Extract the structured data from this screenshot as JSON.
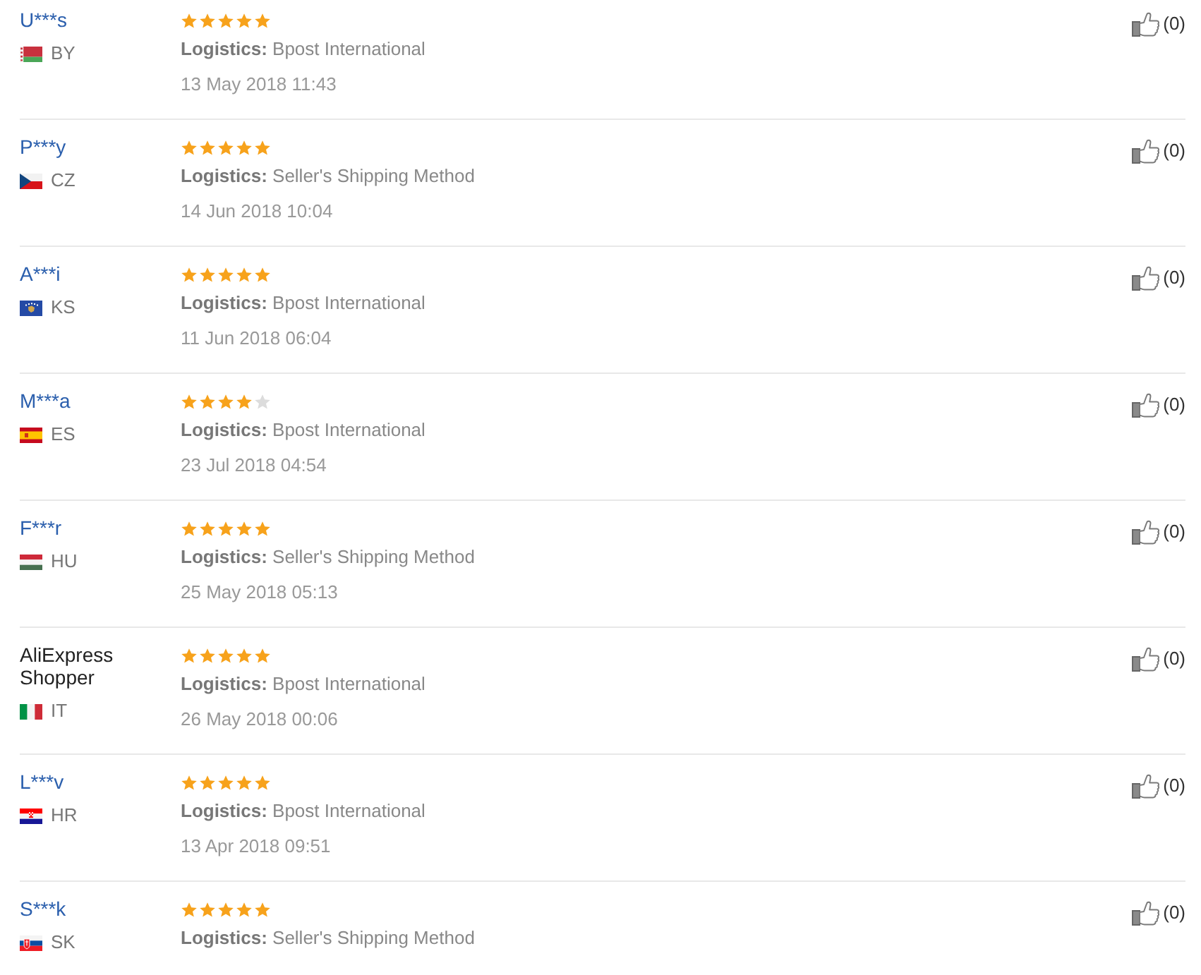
{
  "reviews": [
    {
      "kind": "link",
      "name": "U***s",
      "country": {
        "kind": "belarus",
        "code": "BY"
      },
      "stars": 5,
      "logistics": "**Logistics:** Bpost International",
      "date": "13 May 2018 11:43",
      "likes": "(0)"
    },
    {
      "kind": "link",
      "name": "P***y",
      "country": {
        "kind": "czechia",
        "code": "CZ"
      },
      "stars": 5,
      "logistics": "**Logistics:** Seller's Shipping Method",
      "date": "14 Jun 2018 10:04",
      "likes": "(0)"
    },
    {
      "kind": "link",
      "name": "A***i",
      "country": {
        "kind": "kosovo",
        "code": "KS"
      },
      "stars": 5,
      "logistics": "**Logistics:** Bpost International",
      "date": "11 Jun 2018 06:04",
      "likes": "(0)"
    },
    {
      "kind": "link",
      "name": "M***a",
      "country": {
        "kind": "spain",
        "code": "ES"
      },
      "stars": 4,
      "logistics": "**Logistics:** Bpost International",
      "date": "23 Jul 2018 04:54",
      "likes": "(0)"
    },
    {
      "kind": "link",
      "name": "F***r",
      "country": {
        "kind": "hungary",
        "code": "HU"
      },
      "stars": 5,
      "logistics": "**Logistics:** Seller's Shipping Method",
      "date": "25 May 2018 05:13",
      "likes": "(0)"
    },
    {
      "kind": "plain",
      "name": "AliExpress Shopper",
      "country": {
        "kind": "italy",
        "code": "IT"
      },
      "stars": 5,
      "logistics": "**Logistics:** Bpost International",
      "date": "26 May 2018 00:06",
      "likes": "(0)"
    },
    {
      "kind": "link",
      "name": "L***v",
      "country": {
        "kind": "croatia",
        "code": "HR"
      },
      "stars": 5,
      "logistics": "**Logistics:** Bpost International",
      "date": "13 Apr 2018 09:51",
      "likes": "(0)"
    },
    {
      "kind": "link",
      "name": "S***k",
      "country": {
        "kind": "slovakia",
        "code": "SK"
      },
      "stars": 5,
      "logistics": "**Logistics:** Seller's Shipping Method",
      "likes": "(0)"
    }
  ]
}
